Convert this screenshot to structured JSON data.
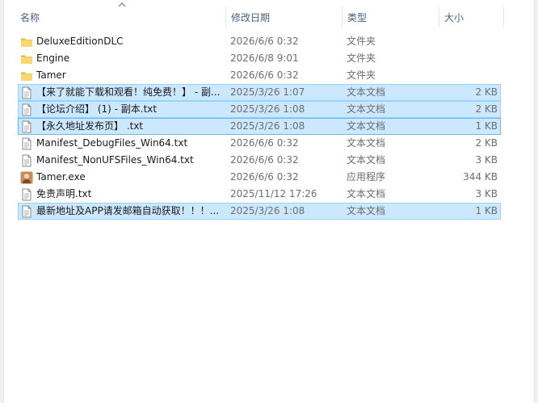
{
  "columns": {
    "name": "名称",
    "date": "修改日期",
    "type": "类型",
    "size": "大小"
  },
  "files": [
    {
      "name": "DeluxeEditionDLC",
      "date": "2026/6/6 0:32",
      "type": "文件夹",
      "size": "",
      "icon": "folder-icon",
      "selected": false
    },
    {
      "name": "Engine",
      "date": "2026/6/8 9:01",
      "type": "文件夹",
      "size": "",
      "icon": "folder-icon",
      "selected": false
    },
    {
      "name": "Tamer",
      "date": "2026/6/6 0:32",
      "type": "文件夹",
      "size": "",
      "icon": "folder-icon",
      "selected": false
    },
    {
      "name": "【来了就能下载和观看！纯免费！】 - 副...",
      "date": "2025/3/26 1:07",
      "type": "文本文档",
      "size": "2 KB",
      "icon": "text-file-icon",
      "selected": true
    },
    {
      "name": "【论坛介绍】 (1) - 副本.txt",
      "date": "2025/3/26 1:08",
      "type": "文本文档",
      "size": "2 KB",
      "icon": "text-file-icon",
      "selected": true
    },
    {
      "name": "【永久地址发布页】 .txt",
      "date": "2025/3/26 1:08",
      "type": "文本文档",
      "size": "1 KB",
      "icon": "text-file-icon",
      "selected": true,
      "focused": true
    },
    {
      "name": "Manifest_DebugFiles_Win64.txt",
      "date": "2026/6/6 0:32",
      "type": "文本文档",
      "size": "2 KB",
      "icon": "text-file-icon",
      "selected": false
    },
    {
      "name": "Manifest_NonUFSFiles_Win64.txt",
      "date": "2026/6/6 0:32",
      "type": "文本文档",
      "size": "3 KB",
      "icon": "text-file-icon",
      "selected": false
    },
    {
      "name": "Tamer.exe",
      "date": "2026/6/6 0:32",
      "type": "应用程序",
      "size": "344 KB",
      "icon": "app-exe-icon",
      "selected": false
    },
    {
      "name": "免责声明.txt",
      "date": "2025/11/12 17:26",
      "type": "文本文档",
      "size": "3 KB",
      "icon": "text-file-icon",
      "selected": false
    },
    {
      "name": "最新地址及APP请发邮箱自动获取！！！...",
      "date": "2025/3/26 1:08",
      "type": "文本文档",
      "size": "1 KB",
      "icon": "text-file-icon",
      "selected": true
    }
  ],
  "colors": {
    "selection_bg": "#cce8ff",
    "selection_border": "#99d1ff",
    "folder": "#f8d775",
    "header_text": "#4c607a"
  }
}
